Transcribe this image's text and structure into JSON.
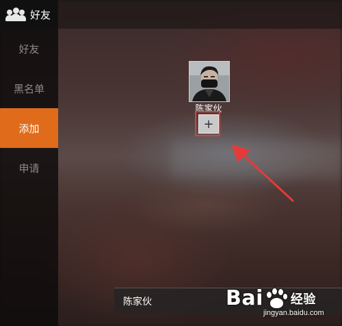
{
  "header": {
    "title": "好友",
    "icon": "friends-icon"
  },
  "sidebar": {
    "items": [
      {
        "label": "好友",
        "active": false
      },
      {
        "label": "黑名单",
        "active": false
      },
      {
        "label": "添加",
        "active": true
      },
      {
        "label": "申请",
        "active": false
      }
    ]
  },
  "result": {
    "name": "陈家伙",
    "add_label": "+"
  },
  "bottom_bar": {
    "label": "陈家伙"
  },
  "watermark": {
    "brand_left": "Bai",
    "brand_right": "经验",
    "url": "jingyan.baidu.com"
  },
  "colors": {
    "accent": "#e06b1b",
    "highlight": "#e63a3a"
  }
}
